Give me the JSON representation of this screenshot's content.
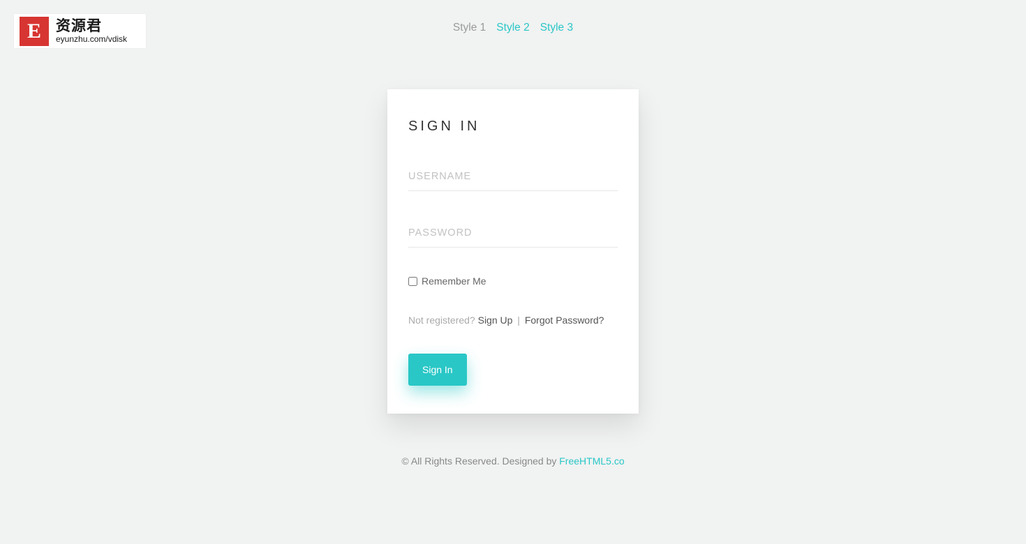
{
  "logo": {
    "badge_letter": "E",
    "cn_text": "资源君",
    "en_text": "eyunzhu.com/vdisk"
  },
  "nav": {
    "style1": "Style 1",
    "style2": "Style 2",
    "style3": "Style 3"
  },
  "card": {
    "title": "SIGN IN",
    "username_placeholder": "USERNAME",
    "password_placeholder": "PASSWORD",
    "remember_label": "Remember Me",
    "not_registered": "Not registered? ",
    "sign_up": "Sign Up",
    "separator": " | ",
    "forgot": "Forgot Password?",
    "submit_label": "Sign In"
  },
  "footer": {
    "text": "© All Rights Reserved. Designed by ",
    "link": "FreeHTML5.co"
  },
  "colors": {
    "accent": "#29c7c6",
    "brand_red": "#d73532",
    "page_bg": "#f1f2f2"
  }
}
